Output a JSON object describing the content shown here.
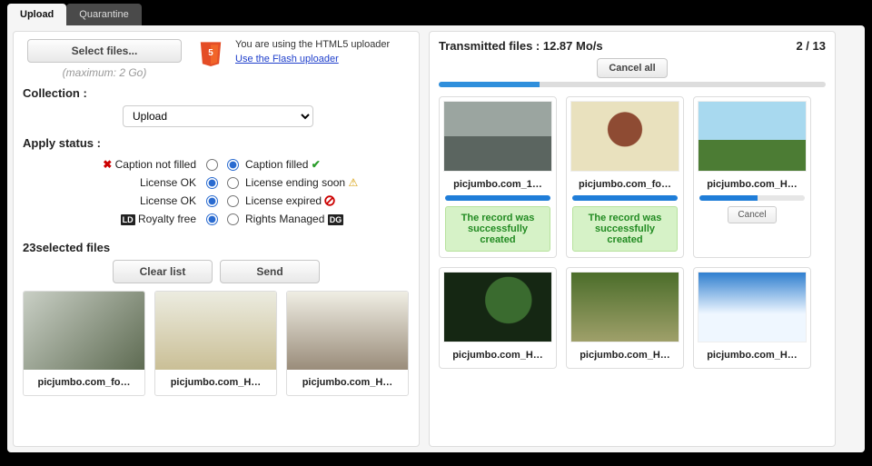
{
  "tabs": {
    "upload": "Upload",
    "quarantine": "Quarantine"
  },
  "left": {
    "select_files": "Select files...",
    "max_note": "(maximum: 2 Go)",
    "uploader_note": "You are using the HTML5 uploader",
    "flash_link": "Use the Flash uploader",
    "collection_label": "Collection :",
    "collection_value": "Upload",
    "apply_status_label": "Apply status :",
    "status": {
      "caption_not_filled": "Caption not filled",
      "caption_filled": "Caption filled",
      "license_ok": "License OK",
      "license_ending": "License ending soon",
      "license_expired": "License expired",
      "royalty_free": "Royalty free",
      "rights_managed": "Rights Managed",
      "ld_badge": "LD",
      "dg_badge": "DG"
    },
    "selected_header": "23selected files",
    "clear_list": "Clear list",
    "send": "Send",
    "thumbs": [
      {
        "name": "picjumbo.com_fo…"
      },
      {
        "name": "picjumbo.com_H…"
      },
      {
        "name": "picjumbo.com_H…"
      }
    ]
  },
  "right": {
    "title": "Transmitted files : 12.87 Mo/s",
    "count": "2 / 13",
    "cancel_all": "Cancel all",
    "success_msg": "The record was successfully created",
    "cancel": "Cancel",
    "files": [
      {
        "name": "picjumbo.com_1…",
        "status": "done"
      },
      {
        "name": "picjumbo.com_fo…",
        "status": "done"
      },
      {
        "name": "picjumbo.com_H…",
        "status": "uploading"
      },
      {
        "name": "picjumbo.com_H…",
        "status": "queued"
      },
      {
        "name": "picjumbo.com_H…",
        "status": "queued"
      },
      {
        "name": "picjumbo.com_H…",
        "status": "queued"
      }
    ]
  }
}
